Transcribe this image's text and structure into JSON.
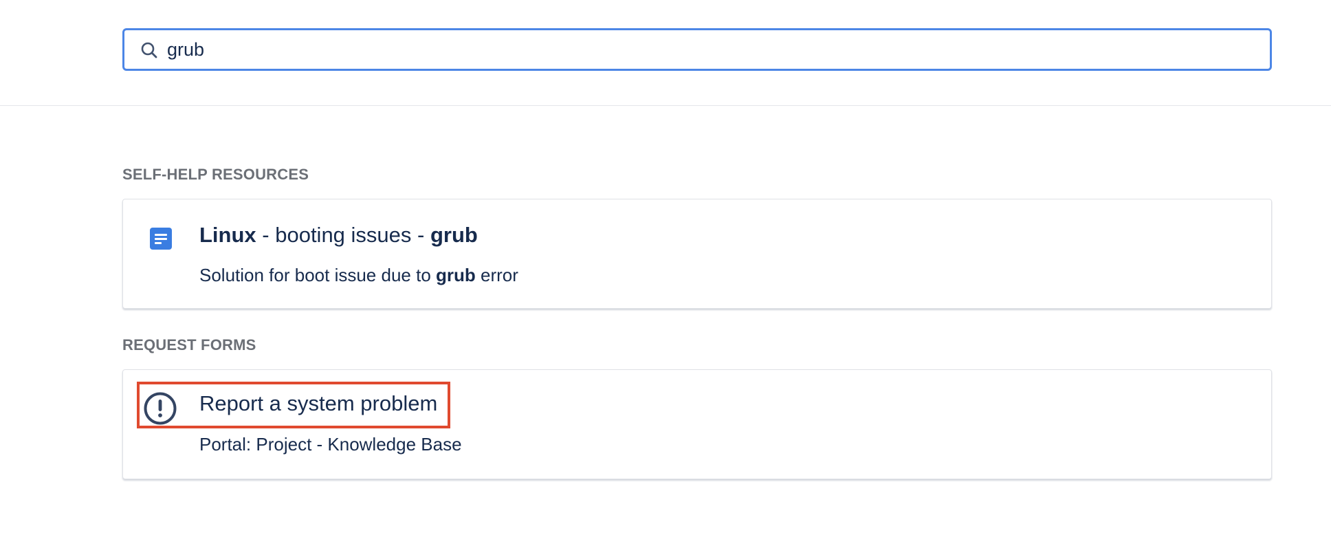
{
  "search": {
    "value": "grub",
    "icon": "search-icon"
  },
  "self_help": {
    "heading": "SELF-HELP RESOURCES",
    "item": {
      "icon": "document-icon",
      "title_pre": "Linux",
      "title_mid": " - booting issues - ",
      "title_post": "grub",
      "desc_pre": "Solution for boot issue due to ",
      "desc_bold": "grub",
      "desc_post": " error"
    }
  },
  "request_forms": {
    "heading": "REQUEST FORMS",
    "item": {
      "icon": "exclamation-circle-icon",
      "title": "Report a system problem",
      "desc": "Portal: Project - Knowledge Base"
    }
  },
  "colors": {
    "focus_border": "#4c86e6",
    "highlight": "#e04a2f",
    "doc_icon": "#3a7de1",
    "text": "#172b4d",
    "heading": "#6b6f76"
  }
}
